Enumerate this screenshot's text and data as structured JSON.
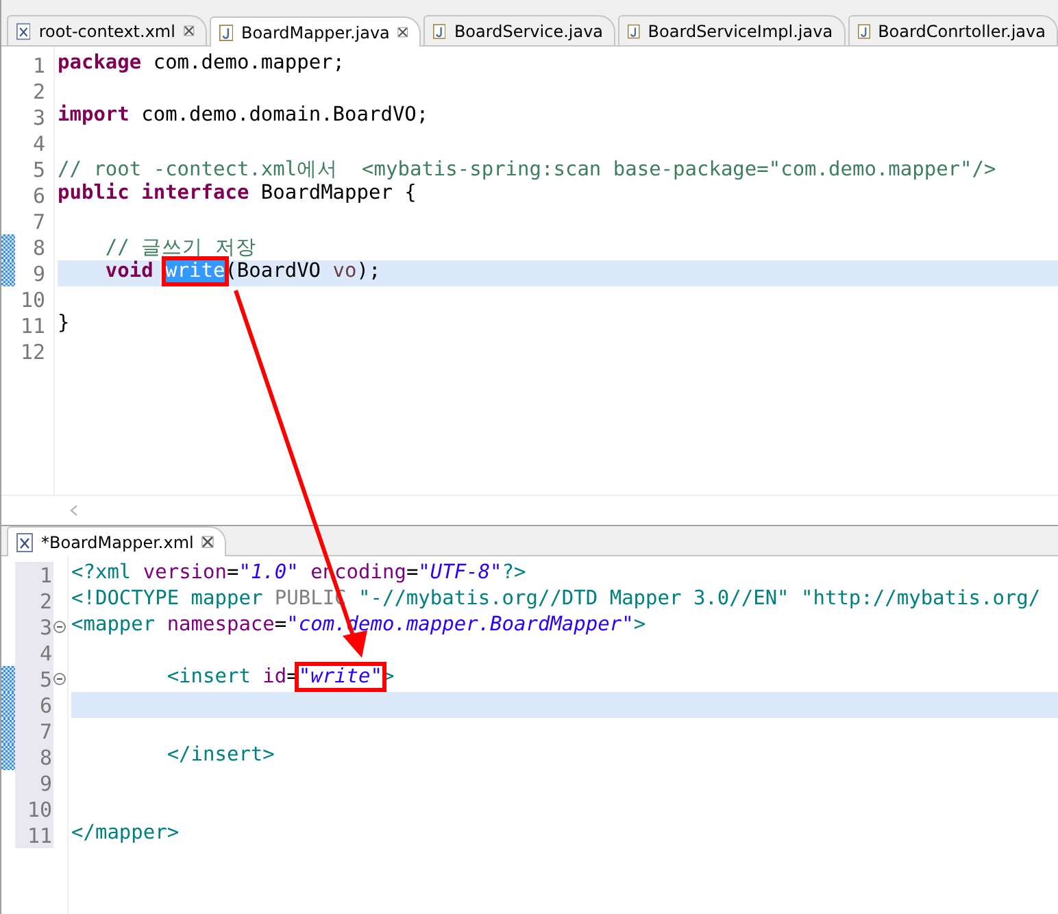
{
  "top_editor": {
    "tabs": [
      {
        "label": "root-context.xml",
        "kind": "xml",
        "selected": false,
        "closable": true
      },
      {
        "label": "BoardMapper.java",
        "kind": "java",
        "selected": true,
        "closable": true
      },
      {
        "label": "BoardService.java",
        "kind": "java",
        "selected": false,
        "closable": false
      },
      {
        "label": "BoardServiceImpl.java",
        "kind": "java",
        "selected": false,
        "closable": false
      },
      {
        "label": "BoardConrtoller.java",
        "kind": "java",
        "selected": false,
        "closable": false
      }
    ],
    "lines": [
      {
        "number": "1",
        "current": false,
        "changed": false,
        "indented": false,
        "tokens": [
          {
            "kind": "keyword",
            "text": "package"
          },
          {
            "kind": "plain",
            "text": " com.demo.mapper;"
          }
        ]
      },
      {
        "number": "2",
        "current": false,
        "changed": false
      },
      {
        "number": "3",
        "current": false,
        "changed": false,
        "indented": false,
        "tokens": [
          {
            "kind": "keyword",
            "text": "import"
          },
          {
            "kind": "plain",
            "text": " com.demo.domain.BoardVO;"
          }
        ]
      },
      {
        "number": "4",
        "current": false,
        "changed": false
      },
      {
        "number": "5",
        "current": false,
        "changed": false,
        "indented": false,
        "tokens": [
          {
            "kind": "comment",
            "text": "// root -contect.xml에서  <mybatis-spring:scan base-package=\"com.demo.mapper\"/>"
          }
        ]
      },
      {
        "number": "6",
        "current": false,
        "changed": false,
        "indented": false,
        "tokens": [
          {
            "kind": "keyword",
            "text": "public interface"
          },
          {
            "kind": "plain",
            "text": " BoardMapper {"
          }
        ]
      },
      {
        "number": "7",
        "current": false,
        "changed": false
      },
      {
        "number": "8",
        "current": false,
        "changed": true,
        "indented": true,
        "tokens": [
          {
            "kind": "comment",
            "text": "// 글쓰기 저장"
          }
        ]
      },
      {
        "number": "9",
        "current": true,
        "changed": true,
        "indented": true,
        "tokens": [
          {
            "kind": "keyword",
            "text": "void"
          },
          {
            "kind": "plain",
            "text": "write",
            "spaced": true,
            "selected": true,
            "boxed": true
          },
          {
            "kind": "plain",
            "text": "(BoardVO"
          },
          {
            "kind": "param",
            "text": "vo",
            "spaced": true
          },
          {
            "kind": "plain",
            "text": ");"
          }
        ]
      },
      {
        "number": "10",
        "current": false,
        "changed": false
      },
      {
        "number": "11",
        "current": false,
        "changed": false,
        "indented": false,
        "tokens": [
          {
            "kind": "plain",
            "text": "}"
          }
        ]
      },
      {
        "number": "12",
        "current": false,
        "changed": false
      }
    ]
  },
  "bottom_editor": {
    "tabs": [
      {
        "label": "*BoardMapper.xml",
        "kind": "xml",
        "selected": true,
        "closable": true
      }
    ],
    "lines": [
      {
        "number": "1",
        "current": false,
        "changed": false,
        "foldable": false,
        "indented": false,
        "tokens": [
          {
            "kind": "tag",
            "text": "<?xml"
          },
          {
            "kind": "attr",
            "text": "version",
            "spaced": true
          },
          {
            "kind": "plain",
            "text": "="
          },
          {
            "kind": "value",
            "text": "\"1.0\""
          },
          {
            "kind": "attr",
            "text": "encoding",
            "spaced": true
          },
          {
            "kind": "plain",
            "text": "="
          },
          {
            "kind": "value",
            "text": "\"UTF-8\""
          },
          {
            "kind": "tag",
            "text": "?>"
          }
        ]
      },
      {
        "number": "2",
        "current": false,
        "changed": false,
        "foldable": false,
        "indented": false,
        "tokens": [
          {
            "kind": "tag",
            "text": "<!DOCTYPE mapper"
          },
          {
            "kind": "doctype",
            "text": "PUBLIC",
            "spaced": true
          },
          {
            "kind": "tag",
            "text": "\"-//mybatis.org//DTD Mapper 3.0//EN\" \"http://mybatis.org/",
            "spaced": true
          }
        ]
      },
      {
        "number": "3",
        "current": false,
        "changed": false,
        "foldable": true,
        "indented": false,
        "tokens": [
          {
            "kind": "tag",
            "text": "<mapper"
          },
          {
            "kind": "attr",
            "text": "namespace",
            "spaced": true
          },
          {
            "kind": "plain",
            "text": "="
          },
          {
            "kind": "value",
            "text": "\"com.demo.mapper.BoardMapper\""
          },
          {
            "kind": "tag",
            "text": ">"
          }
        ]
      },
      {
        "number": "4",
        "current": false,
        "changed": false,
        "foldable": false
      },
      {
        "number": "5",
        "current": false,
        "changed": true,
        "foldable": true,
        "indented": true,
        "tokens": [
          {
            "kind": "tag",
            "text": "<insert"
          },
          {
            "kind": "attr",
            "text": "id",
            "spaced": true
          },
          {
            "kind": "plain",
            "text": "="
          },
          {
            "kind": "value",
            "text": "\"write\"",
            "boxed": true
          },
          {
            "kind": "tag",
            "text": ">"
          }
        ]
      },
      {
        "number": "6",
        "current": true,
        "changed": true,
        "foldable": false
      },
      {
        "number": "7",
        "current": false,
        "changed": true,
        "foldable": false
      },
      {
        "number": "8",
        "current": false,
        "changed": true,
        "foldable": false,
        "indented": true,
        "tokens": [
          {
            "kind": "tag",
            "text": "</insert>"
          }
        ]
      },
      {
        "number": "9",
        "current": false,
        "changed": false,
        "foldable": false
      },
      {
        "number": "10",
        "current": false,
        "changed": false,
        "foldable": false
      },
      {
        "number": "11",
        "current": false,
        "changed": false,
        "foldable": false,
        "indented": false,
        "tokens": [
          {
            "kind": "tag",
            "text": "</mapper>"
          }
        ]
      }
    ]
  }
}
